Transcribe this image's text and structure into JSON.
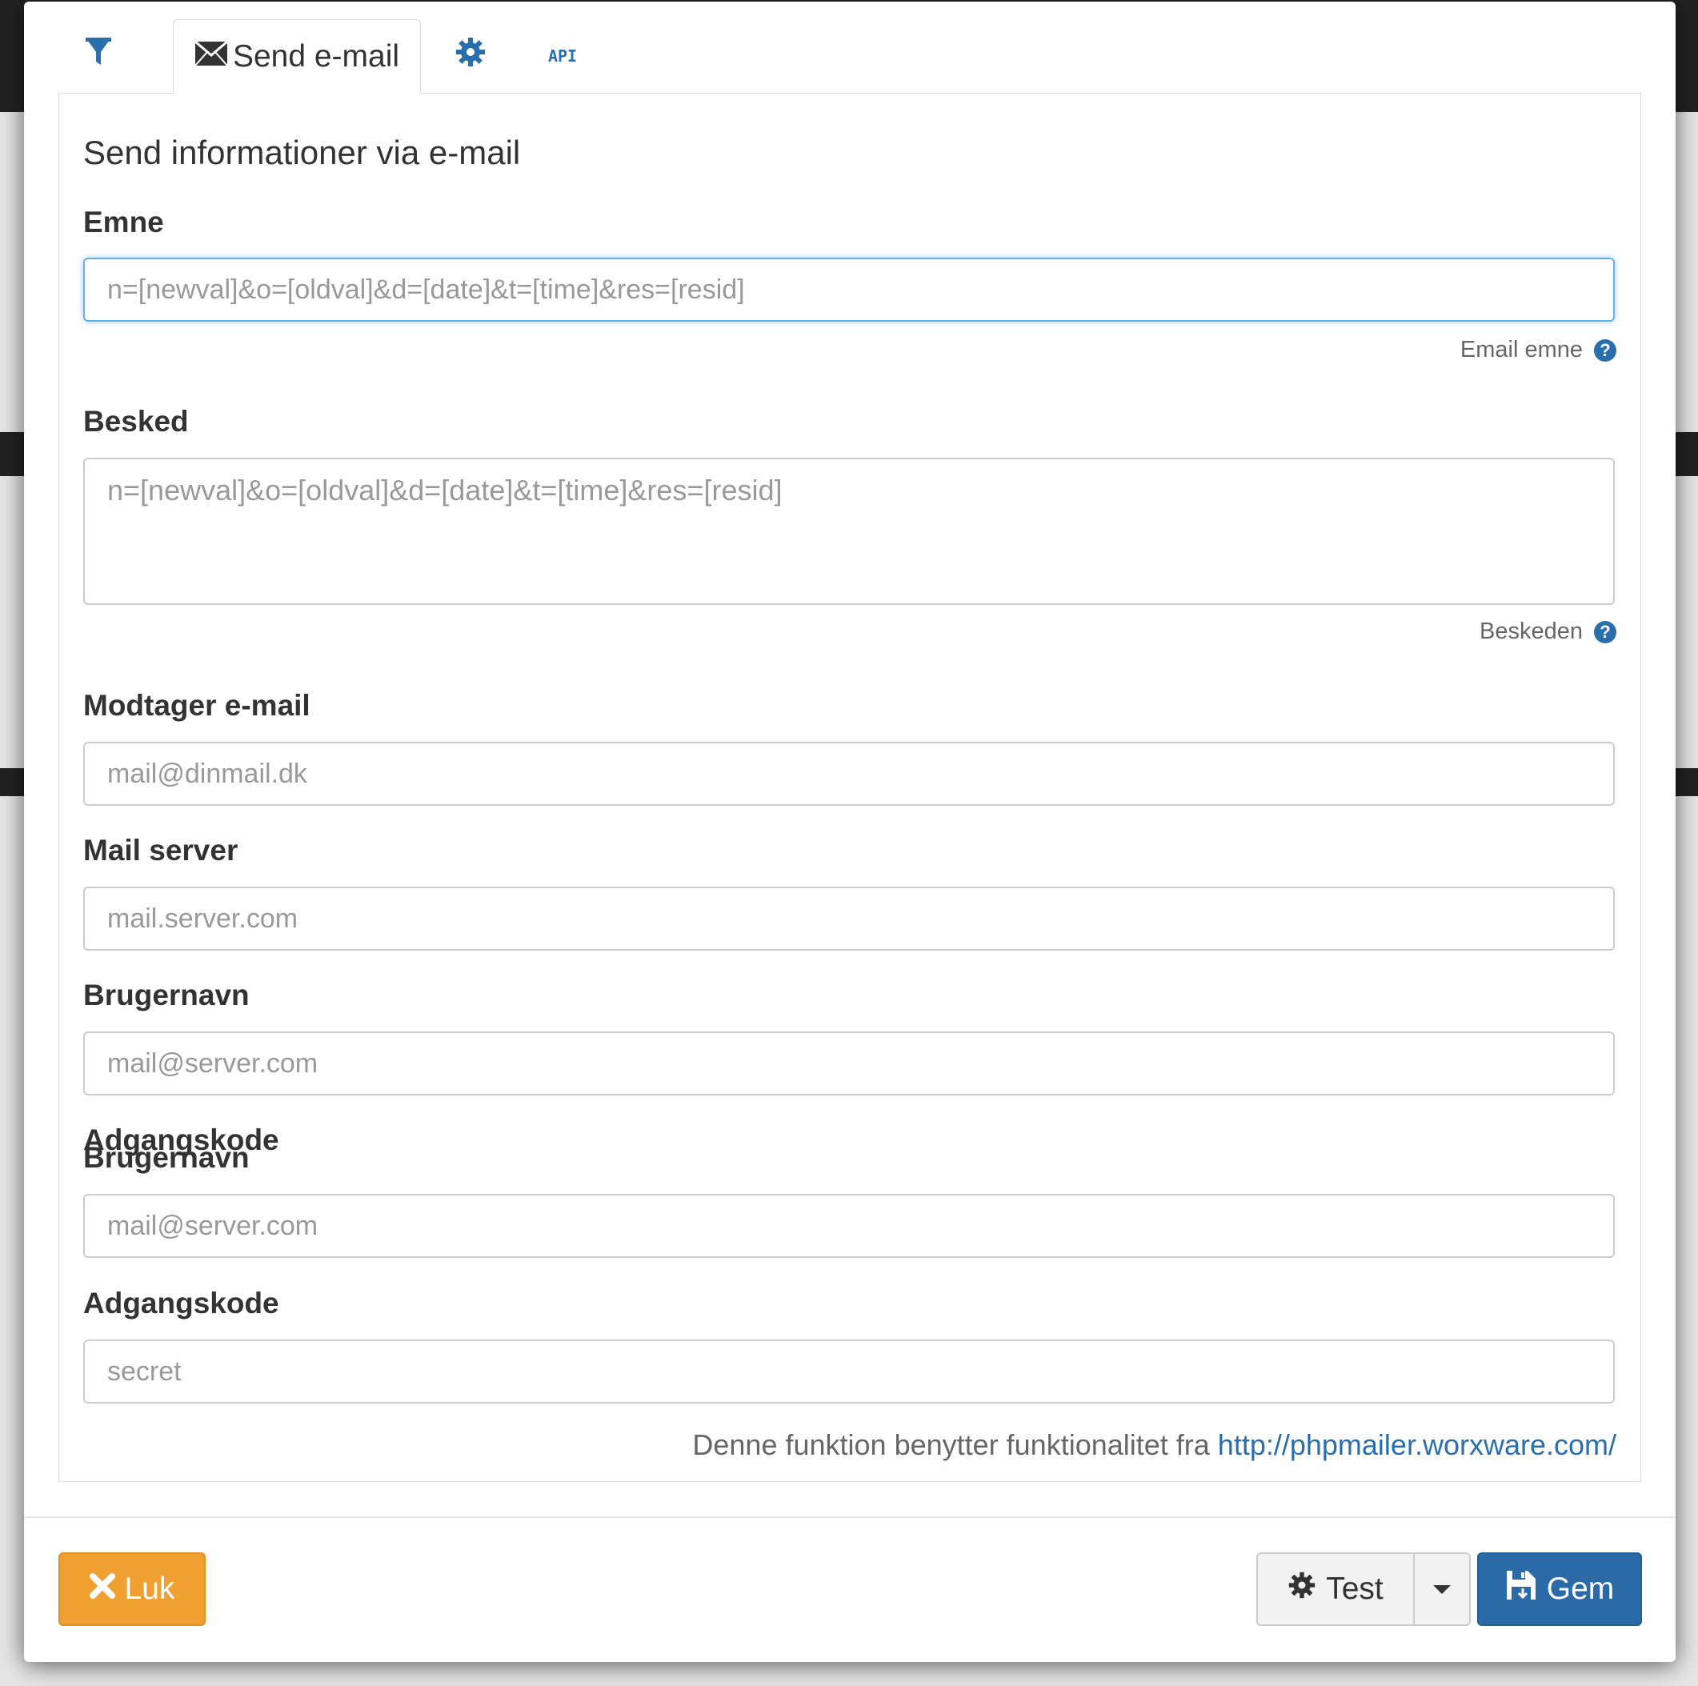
{
  "tabs": {
    "filter_label": "",
    "email_label": "Send e-mail",
    "settings_label": "",
    "api_label": "API"
  },
  "form": {
    "heading": "Send informationer via e-mail",
    "subject": {
      "label": "Emne",
      "placeholder": "n=[newval]&o=[oldval]&d=[date]&t=[time]&res=[resid]",
      "help": "Email emne"
    },
    "message": {
      "label": "Besked",
      "placeholder": "n=[newval]&o=[oldval]&d=[date]&t=[time]&res=[resid]",
      "help": "Beskeden"
    },
    "recipient": {
      "label": "Modtager e-mail",
      "placeholder": "mail@dinmail.dk"
    },
    "server": {
      "label": "Mail server",
      "placeholder": "mail.server.com"
    },
    "username": {
      "label": "Brugernavn",
      "placeholder": "mail@server.com"
    },
    "overlap": {
      "label_back": "Adgangskode",
      "label_front": "Brugernavn",
      "placeholder": "mail@server.com"
    },
    "password": {
      "label": "Adgangskode",
      "placeholder": "secret"
    },
    "footer_text": "Denne funktion benytter funktionalitet fra ",
    "footer_link": "http://phpmailer.worxware.com/"
  },
  "buttons": {
    "close": "Luk",
    "test": "Test",
    "save": "Gem"
  },
  "colors": {
    "accent_blue": "#2a6fad",
    "close_orange": "#f0a030",
    "save_blue": "#2a6aa6"
  }
}
